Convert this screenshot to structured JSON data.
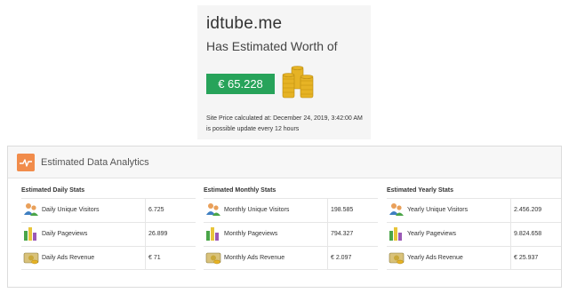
{
  "worth": {
    "domain": "idtube.me",
    "subtitle": "Has Estimated Worth of",
    "amount": "€ 65.228",
    "calculated_at": "Site Price calculated at: December 24, 2019, 3:42:00 AM",
    "update_note": "is possible update every 12 hours",
    "badge_color": "#27a35a",
    "icon": "gold-coins-icon"
  },
  "analytics": {
    "title": "Estimated Data Analytics",
    "accent_color": "#f18c4b",
    "columns": [
      {
        "title": "Estimated Daily Stats",
        "rows": [
          {
            "label": "Daily Unique Visitors",
            "value": "6.725",
            "icon": "users-icon"
          },
          {
            "label": "Daily Pageviews",
            "value": "26.899",
            "icon": "bar-chart-icon"
          },
          {
            "label": "Daily Ads Revenue",
            "value": "€ 71",
            "icon": "money-icon"
          }
        ]
      },
      {
        "title": "Estimated Monthly Stats",
        "rows": [
          {
            "label": "Monthly Unique Visitors",
            "value": "198.585",
            "icon": "users-icon"
          },
          {
            "label": "Monthly Pageviews",
            "value": "794.327",
            "icon": "bar-chart-icon"
          },
          {
            "label": "Monthly Ads Revenue",
            "value": "€ 2.097",
            "icon": "money-icon"
          }
        ]
      },
      {
        "title": "Estimated Yearly Stats",
        "rows": [
          {
            "label": "Yearly Unique Visitors",
            "value": "2.456.209",
            "icon": "users-icon"
          },
          {
            "label": "Yearly Pageviews",
            "value": "9.824.658",
            "icon": "bar-chart-icon"
          },
          {
            "label": "Yearly Ads Revenue",
            "value": "€ 25.937",
            "icon": "money-icon"
          }
        ]
      }
    ]
  }
}
